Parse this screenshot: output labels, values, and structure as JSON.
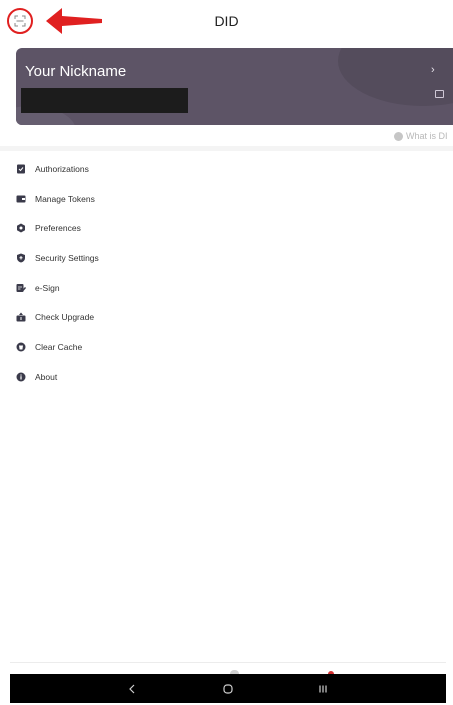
{
  "header": {
    "title": "DID",
    "scan_icon": "scan-icon",
    "annotation_arrow_color": "#e02020"
  },
  "profile_card": {
    "nickname": "Your Nickname",
    "background_color": "#5d5466",
    "chevron_icon": "chevron-right-icon",
    "copy_icon": "copy-icon"
  },
  "help_link": {
    "label": "What is DI",
    "icon": "question-circle-icon"
  },
  "menu": {
    "items": [
      {
        "label": "Authorizations",
        "icon": "authorization-icon"
      },
      {
        "label": "Manage Tokens",
        "icon": "wallet-icon"
      },
      {
        "label": "Preferences",
        "icon": "preferences-icon"
      },
      {
        "label": "Security Settings",
        "icon": "shield-icon"
      },
      {
        "label": "e-Sign",
        "icon": "esign-icon"
      },
      {
        "label": "Check Upgrade",
        "icon": "upgrade-icon"
      },
      {
        "label": "Clear Cache",
        "icon": "clear-cache-icon"
      },
      {
        "label": "About",
        "icon": "info-icon"
      }
    ]
  },
  "system_nav": {
    "back_icon": "back-icon",
    "home_icon": "home-icon",
    "recents_icon": "recents-icon"
  }
}
